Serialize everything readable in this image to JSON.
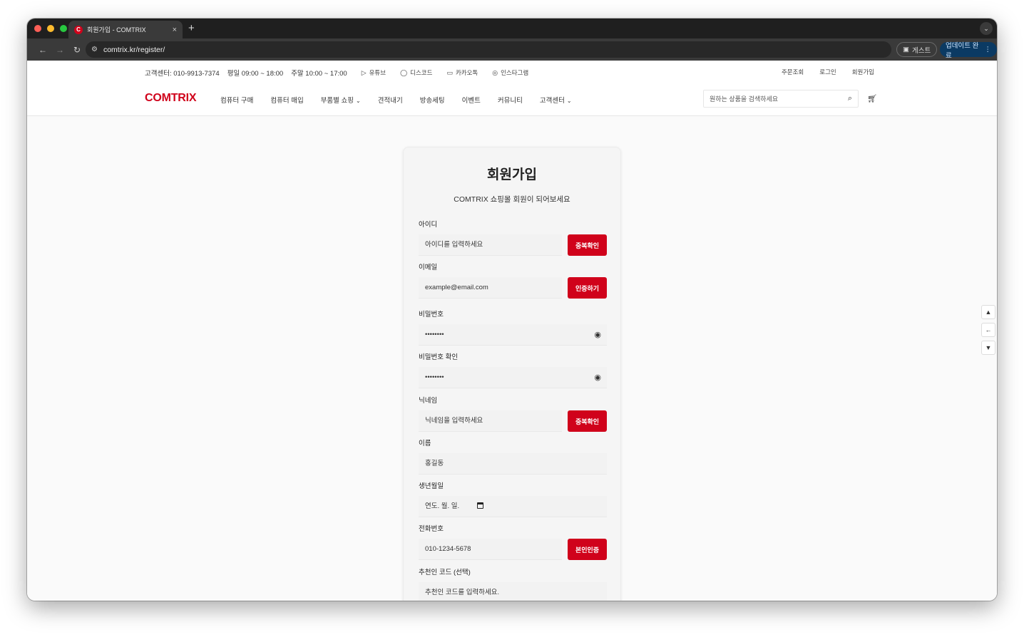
{
  "browser": {
    "tab_title": "회원가입 - COMTRIX",
    "favicon_letter": "C",
    "new_tab": "+",
    "tab_close": "×",
    "url": "comtrix.kr/register/",
    "guest_label": "게스트",
    "update_label": "업데이트 완료"
  },
  "topbar": {
    "phone": "고객센터: 010-9913-7374",
    "weekday_hours": "평일 09:00 ~ 18:00",
    "weekend_hours": "주말 10:00 ~ 17:00",
    "social": [
      {
        "icon": "youtube-icon",
        "label": "유튜브"
      },
      {
        "icon": "discord-icon",
        "label": "디스코드"
      },
      {
        "icon": "kakaotalk-icon",
        "label": "카카오톡"
      },
      {
        "icon": "instagram-icon",
        "label": "인스타그램"
      }
    ],
    "links": [
      "주문조회",
      "로그인",
      "회원가입"
    ]
  },
  "nav": {
    "logo": "COMTRIX",
    "menu": [
      {
        "label": "컴퓨터 구매",
        "dropdown": false
      },
      {
        "label": "컴퓨터 매입",
        "dropdown": false
      },
      {
        "label": "부품별 쇼핑",
        "dropdown": true
      },
      {
        "label": "견적내기",
        "dropdown": false
      },
      {
        "label": "방송세팅",
        "dropdown": false
      },
      {
        "label": "이벤트",
        "dropdown": false
      },
      {
        "label": "커뮤니티",
        "dropdown": false
      },
      {
        "label": "고객센터",
        "dropdown": true
      }
    ],
    "search_placeholder": "원하는 상품을 검색하세요"
  },
  "form": {
    "title": "회원가입",
    "subtitle": "COMTRIX 쇼핑몰 회원이 되어보세요",
    "id": {
      "label": "아이디",
      "placeholder": "아이디를 입력하세요",
      "button": "중복확인"
    },
    "email": {
      "label": "이메일",
      "placeholder": "example@email.com",
      "button": "인증하기"
    },
    "password": {
      "label": "비밀번호",
      "value": "••••••••"
    },
    "password_confirm": {
      "label": "비밀번호 확인",
      "value": "••••••••"
    },
    "nickname": {
      "label": "닉네임",
      "placeholder": "닉네임을 입력하세요",
      "button": "중복확인"
    },
    "name": {
      "label": "이름",
      "placeholder": "홍길동"
    },
    "birthdate": {
      "label": "생년월일",
      "placeholder": "연도. 월. 일."
    },
    "phone": {
      "label": "전화번호",
      "placeholder": "010-1234-5678",
      "button": "본인인증"
    },
    "referral": {
      "label": "추천인 코드 (선택)",
      "placeholder": "추천인 코드를 입력하세요."
    }
  },
  "colors": {
    "brand": "#d0021b"
  }
}
